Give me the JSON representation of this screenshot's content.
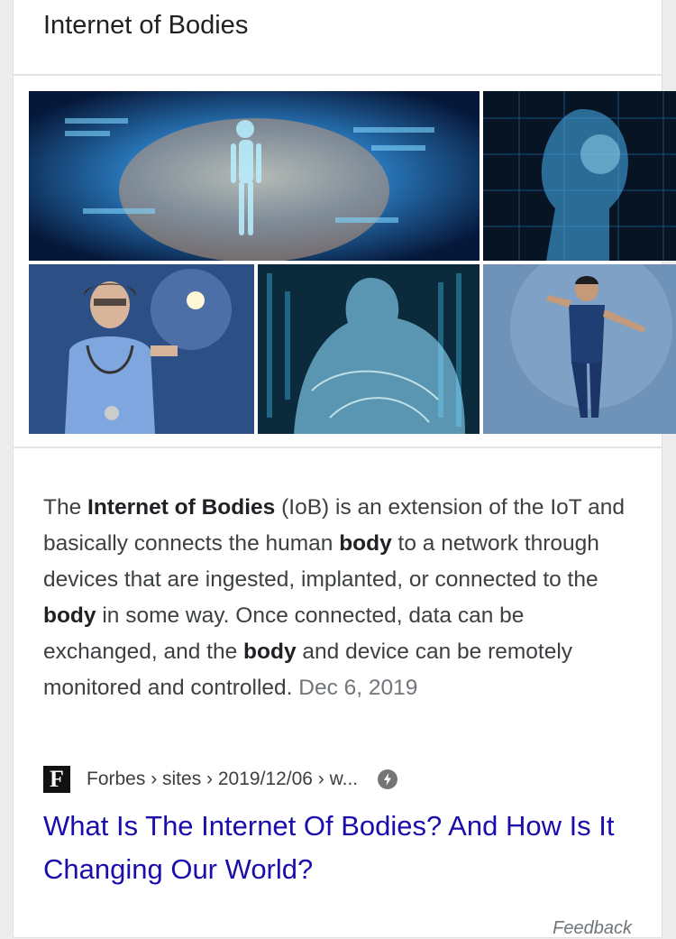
{
  "panel": {
    "title": "Internet of Bodies"
  },
  "images": [
    {
      "name": "image-hand-hologram",
      "icon": "image-thumbnail"
    },
    {
      "name": "image-digital-head",
      "icon": "image-thumbnail"
    },
    {
      "name": "image-doctor-touchscreen",
      "icon": "image-thumbnail"
    },
    {
      "name": "image-wireframe-body",
      "icon": "image-thumbnail"
    },
    {
      "name": "image-man-gesturing",
      "icon": "image-thumbnail"
    }
  ],
  "description": {
    "t1": "The ",
    "b1": "Internet of Bodies",
    "t2": " (IoB) is an extension of the IoT and basically connects the human ",
    "b2": "body",
    "t3": " to a network through devices that are ingested, implanted, or connected to the ",
    "b3": "body",
    "t4": " in some way. Once connected, data can be exchanged, and the ",
    "b4": "body",
    "t5": " and device can be remotely monitored and controlled.",
    "date": "Dec 6, 2019"
  },
  "source": {
    "favicon_letter": "F",
    "breadcrumb": "Forbes › sites › 2019/12/06 › w...",
    "amp_icon": "lightning-icon"
  },
  "result": {
    "headline": "What Is The Internet Of Bodies? And How Is It Changing Our World?"
  },
  "footer": {
    "feedback": "Feedback"
  },
  "colors": {
    "link": "#1a0dab",
    "text": "#3c4043",
    "muted": "#70757a"
  }
}
